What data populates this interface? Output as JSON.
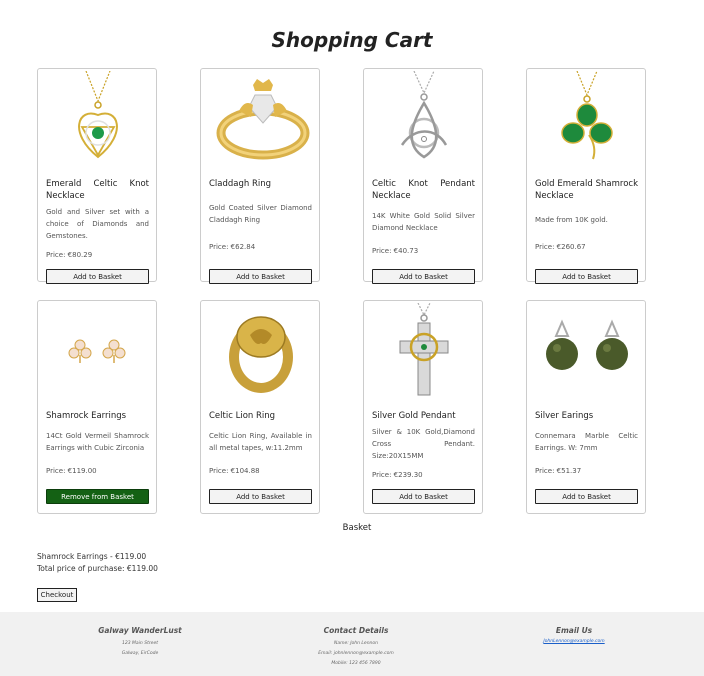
{
  "page": {
    "title": "Shopping Cart"
  },
  "products": [
    {
      "name": "Emerald Celtic Knot Necklace",
      "description": "Gold and Silver set with a choice of Diamonds and Gemstones.",
      "price": "Price: €80.29",
      "button": "Add to Basket",
      "image": "emerald-celtic-knot-necklace-image"
    },
    {
      "name": "Claddagh Ring",
      "description": "Gold Coated Silver Diamond Claddagh Ring",
      "price": "Price: €62.84",
      "button": "Add to Basket",
      "image": "claddagh-ring-image"
    },
    {
      "name": "Celtic Knot Pendant Necklace",
      "description": "14K White Gold Solid Silver Diamond Necklace",
      "price": "Price: €40.73",
      "button": "Add to Basket",
      "image": "celtic-knot-pendant-image"
    },
    {
      "name": "Gold Emerald Shamrock Necklace",
      "description": "Made from 10K gold.",
      "price": "Price: €260.67",
      "button": "Add to Basket",
      "image": "shamrock-necklace-image"
    },
    {
      "name": "Shamrock Earrings",
      "description": "14Ct Gold Vermeil Shamrock Earrings with Cubic Zirconia",
      "price": "Price: €119.00",
      "button": "Remove from Basket",
      "image": "shamrock-earrings-image"
    },
    {
      "name": "Celtic Lion Ring",
      "description": "Celtic Lion Ring, Available in all metal tapes, w:11.2mm",
      "price": "Price: €104.88",
      "button": "Add to Basket",
      "image": "celtic-lion-ring-image"
    },
    {
      "name": "Silver Gold Pendant",
      "description": "Silver & 10K Gold,Diamond Cross Pendant. Size:20X15MM",
      "price": "Price: €239.30",
      "button": "Add to Basket",
      "image": "cross-pendant-image"
    },
    {
      "name": "Silver Earings",
      "description": "Connemara Marble Celtic Earrings. W: 7mm",
      "price": "Price: €51.37",
      "button": "Add to Basket",
      "image": "marble-earrings-image"
    }
  ],
  "basket": {
    "title": "Basket",
    "items": [
      "Shamrock Earrings - €119.00"
    ],
    "total": "Total price of purchase: €119.00",
    "checkout_label": "Checkout"
  },
  "footer": {
    "brand": {
      "title": "Galway WanderLust",
      "lines": [
        "123 Main Street",
        "Galway, EirCode"
      ]
    },
    "contact": {
      "title": "Contact Details",
      "lines": [
        "Name: John Lennon",
        "Email: johnlennon@example.com",
        "Mobile: 123 456 7890"
      ]
    },
    "email": {
      "title": "Email Us",
      "link": "JohnLennon@example.com"
    }
  },
  "colors": {
    "remove_button": "#146114",
    "link": "#1a5fc9",
    "footer_bg": "#f1f1f1"
  }
}
